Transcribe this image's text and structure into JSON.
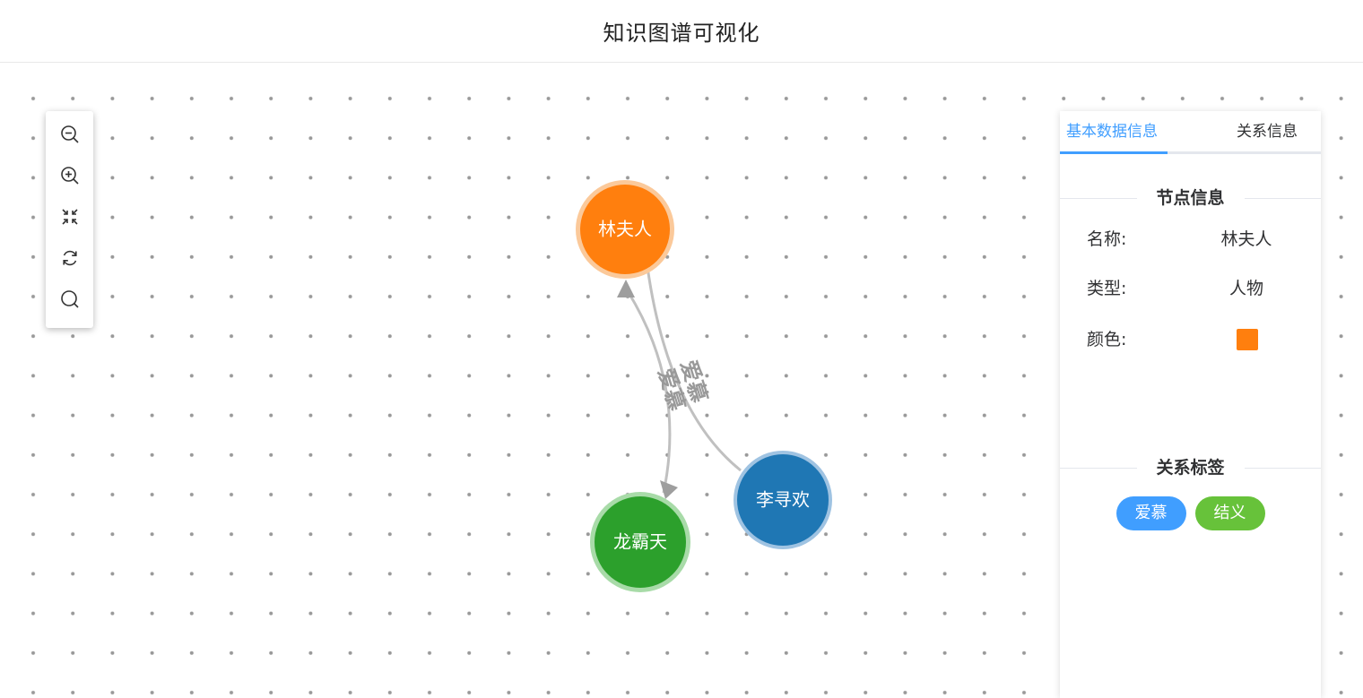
{
  "header": {
    "title": "知识图谱可视化"
  },
  "toolbar": {
    "tools": [
      {
        "icon": "zoom-out-icon"
      },
      {
        "icon": "zoom-in-icon"
      },
      {
        "icon": "fit-view-icon"
      },
      {
        "icon": "refresh-icon"
      },
      {
        "icon": "search-icon"
      }
    ]
  },
  "graph": {
    "nodes": [
      {
        "id": "n1",
        "label": "林夫人",
        "color": "#ff7f0e",
        "halo": "#fbc99a"
      },
      {
        "id": "n2",
        "label": "龙霸天",
        "color": "#2ca02c",
        "halo": "#a8dba8"
      },
      {
        "id": "n3",
        "label": "李寻欢",
        "color": "#1f77b4",
        "halo": "#9fc3e2"
      }
    ],
    "edges": [
      {
        "source": "李寻欢",
        "target": "林夫人",
        "label": "爱慕"
      },
      {
        "source": "林夫人",
        "target": "龙霸天",
        "label": "爱慕"
      }
    ]
  },
  "panel": {
    "tabs": [
      "基本数据信息",
      "关系信息"
    ],
    "active_tab": "基本数据信息",
    "node_section_title": "节点信息",
    "fields": {
      "name_label": "名称:",
      "name_value": "林夫人",
      "type_label": "类型:",
      "type_value": "人物",
      "color_label": "颜色:",
      "color_value": "#ff7f0e"
    },
    "relation_section_title": "关系标签",
    "relation_tags": [
      {
        "label": "爱慕",
        "color": "#409eff"
      },
      {
        "label": "结义",
        "color": "#67c23a"
      }
    ]
  }
}
